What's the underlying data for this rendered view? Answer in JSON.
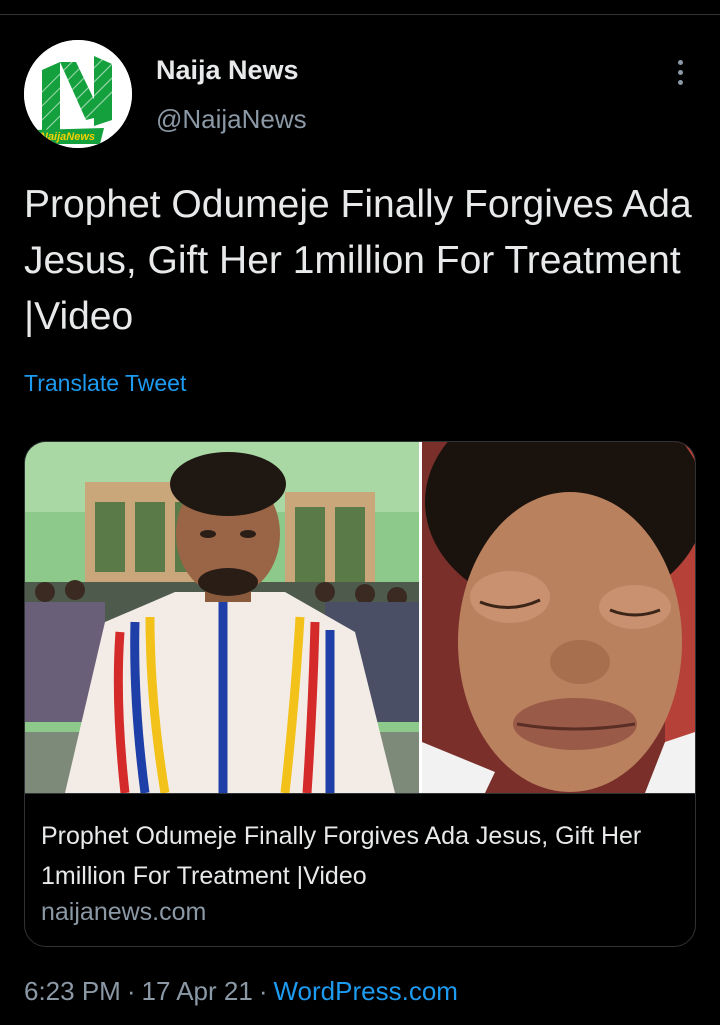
{
  "author": {
    "name": "Naija News",
    "handle": "@NaijaNews",
    "avatar_text": "NaijaNews"
  },
  "tweet": {
    "text": "Prophet Odumeje Finally Forgives Ada Jesus, Gift Her 1million For Treatment |Video",
    "translate_label": "Translate Tweet"
  },
  "card": {
    "title": "Prophet Odumeje Finally Forgives Ada Jesus, Gift Her 1million For Treatment |Video",
    "domain": "naijanews.com"
  },
  "meta": {
    "time": "6:23 PM",
    "date": "17 Apr 21",
    "separator": "·",
    "source": "WordPress.com"
  },
  "icons": {
    "more": "more-vertical-icon"
  },
  "colors": {
    "background": "#000000",
    "text": "#e7e9ea",
    "muted": "#8b98a5",
    "link": "#1d9bf0",
    "brand_green": "#14a03c"
  }
}
